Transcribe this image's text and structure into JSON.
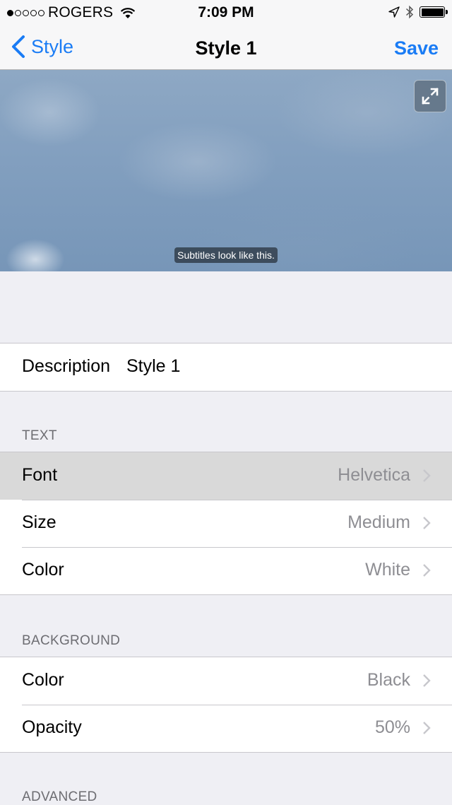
{
  "status_bar": {
    "signal_dots": [
      true,
      false,
      false,
      false,
      false
    ],
    "carrier": "ROGERS",
    "time": "7:09 PM",
    "battery_level": 1.0
  },
  "nav": {
    "back_label": "Style",
    "title": "Style 1",
    "save_label": "Save",
    "tint_color": "#1a7cf5"
  },
  "preview": {
    "subtitle_sample": "Subtitles look like this.",
    "expand_icon": "expand-arrows-icon"
  },
  "description": {
    "label": "Description",
    "value": "Style 1"
  },
  "text_section": {
    "header": "TEXT",
    "rows": [
      {
        "label": "Font",
        "value": "Helvetica",
        "selected": true
      },
      {
        "label": "Size",
        "value": "Medium"
      },
      {
        "label": "Color",
        "value": "White"
      }
    ]
  },
  "background_section": {
    "header": "BACKGROUND",
    "rows": [
      {
        "label": "Color",
        "value": "Black"
      },
      {
        "label": "Opacity",
        "value": "50%"
      }
    ]
  },
  "advanced_section": {
    "header": "ADVANCED"
  }
}
